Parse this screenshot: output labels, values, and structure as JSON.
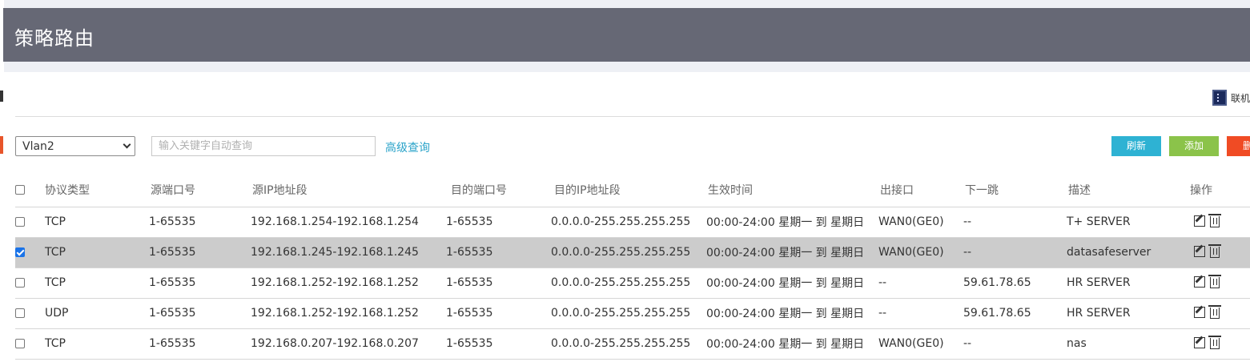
{
  "header": {
    "title": "策略路由"
  },
  "top_right": {
    "linked_label": "联机帮"
  },
  "toolbar": {
    "vlan_selected": "Vlan2",
    "search_placeholder": "输入关键字自动查询",
    "advanced_query_label": "高级查询",
    "refresh_label": "刷新",
    "add_label": "添加",
    "delete_label": "删除"
  },
  "table": {
    "columns": [
      "协议类型",
      "源端口号",
      "源IP地址段",
      "目的端口号",
      "目的IP地址段",
      "生效时间",
      "出接口",
      "下一跳",
      "描述",
      "操作"
    ],
    "rows": [
      {
        "checked": false,
        "protocol": "TCP",
        "src_port": "1-65535",
        "src_ip": "192.168.1.254-192.168.1.254",
        "dst_port": "1-65535",
        "dst_ip": "0.0.0.0-255.255.255.255",
        "time": "00:00-24:00 星期一 到 星期日",
        "out_if": "WAN0(GE0)",
        "next_hop": "--",
        "desc": "T+ SERVER"
      },
      {
        "checked": true,
        "protocol": "TCP",
        "src_port": "1-65535",
        "src_ip": "192.168.1.245-192.168.1.245",
        "dst_port": "1-65535",
        "dst_ip": "0.0.0.0-255.255.255.255",
        "time": "00:00-24:00 星期一 到 星期日",
        "out_if": "WAN0(GE0)",
        "next_hop": "--",
        "desc": "datasafeserver"
      },
      {
        "checked": false,
        "protocol": "TCP",
        "src_port": "1-65535",
        "src_ip": "192.168.1.252-192.168.1.252",
        "dst_port": "1-65535",
        "dst_ip": "0.0.0.0-255.255.255.255",
        "time": "00:00-24:00 星期一 到 星期日",
        "out_if": "--",
        "next_hop": "59.61.78.65",
        "desc": "HR SERVER"
      },
      {
        "checked": false,
        "protocol": "UDP",
        "src_port": "1-65535",
        "src_ip": "192.168.1.252-192.168.1.252",
        "dst_port": "1-65535",
        "dst_ip": "0.0.0.0-255.255.255.255",
        "time": "00:00-24:00 星期一 到 星期日",
        "out_if": "--",
        "next_hop": "59.61.78.65",
        "desc": "HR SERVER"
      },
      {
        "checked": false,
        "protocol": "TCP",
        "src_port": "1-65535",
        "src_ip": "192.168.0.207-192.168.0.207",
        "dst_port": "1-65535",
        "dst_ip": "0.0.0.0-255.255.255.255",
        "time": "00:00-24:00 星期一 到 星期日",
        "out_if": "WAN0(GE0)",
        "next_hop": "--",
        "desc": "nas"
      }
    ]
  },
  "colors": {
    "header_bg": "#666875",
    "refresh": "#2eb2d3",
    "add": "#8bc34a",
    "delete": "#f04b24",
    "link": "#2aa3c9",
    "selected_row": "#cccccc"
  }
}
